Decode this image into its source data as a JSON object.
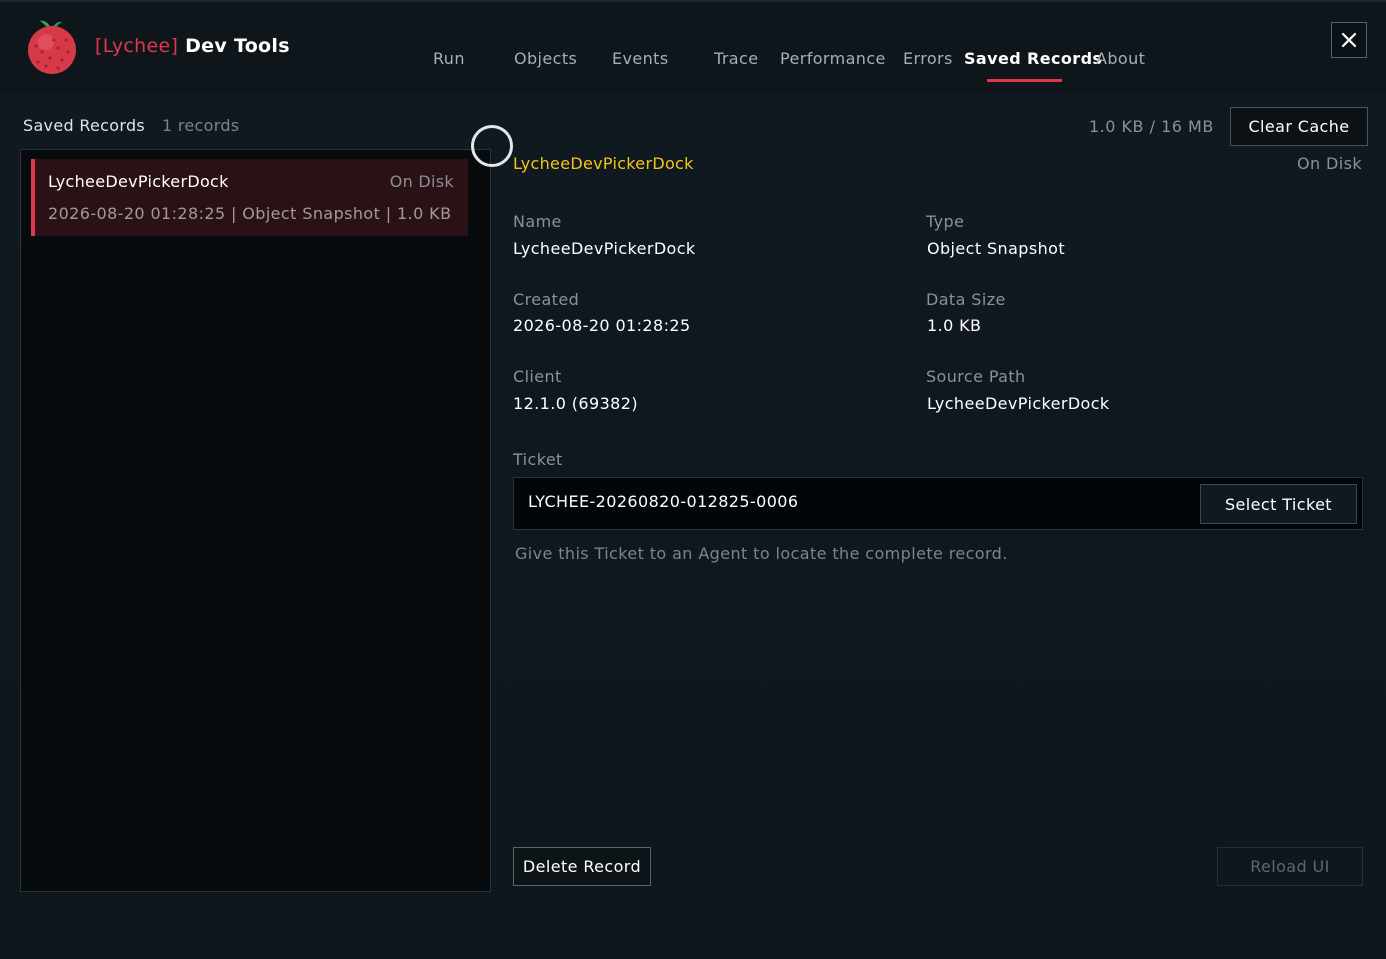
{
  "header": {
    "brand": "[Lychee]",
    "title": "Dev Tools",
    "tabs": [
      {
        "label": "Run"
      },
      {
        "label": "Objects"
      },
      {
        "label": "Events"
      },
      {
        "label": "Trace"
      },
      {
        "label": "Performance"
      },
      {
        "label": "Errors"
      },
      {
        "label": "Saved Records",
        "active": true
      },
      {
        "label": "About"
      }
    ],
    "close_label": "✕",
    "accent_color": "#e0384a"
  },
  "left": {
    "title": "Saved Records",
    "count": "1 records",
    "records": [
      {
        "name": "LycheeDevPickerDock",
        "status": "On Disk",
        "meta": "2026-08-20 01:28:25 | Object Snapshot | 1.0 KB"
      }
    ]
  },
  "detail": {
    "cache_size": "1.0 KB / 16 MB",
    "clear_cache_label": "Clear Cache",
    "title": "LycheeDevPickerDock",
    "status": "On Disk",
    "fields": {
      "name_label": "Name",
      "name_value": "LycheeDevPickerDock",
      "type_label": "Type",
      "type_value": "Object Snapshot",
      "created_label": "Created",
      "created_value": "2026-08-20 01:28:25",
      "size_label": "Data Size",
      "size_value": "1.0 KB",
      "client_label": "Client",
      "client_value": "12.1.0 (69382)",
      "source_label": "Source Path",
      "source_value": "LycheeDevPickerDock"
    },
    "ticket_label": "Ticket",
    "ticket_value": "LYCHEE-20260820-012825-0006",
    "select_ticket_label": "Select Ticket",
    "hint": "Give this Ticket to an Agent to locate the complete record.",
    "delete_label": "Delete Record",
    "reload_label": "Reload UI"
  }
}
